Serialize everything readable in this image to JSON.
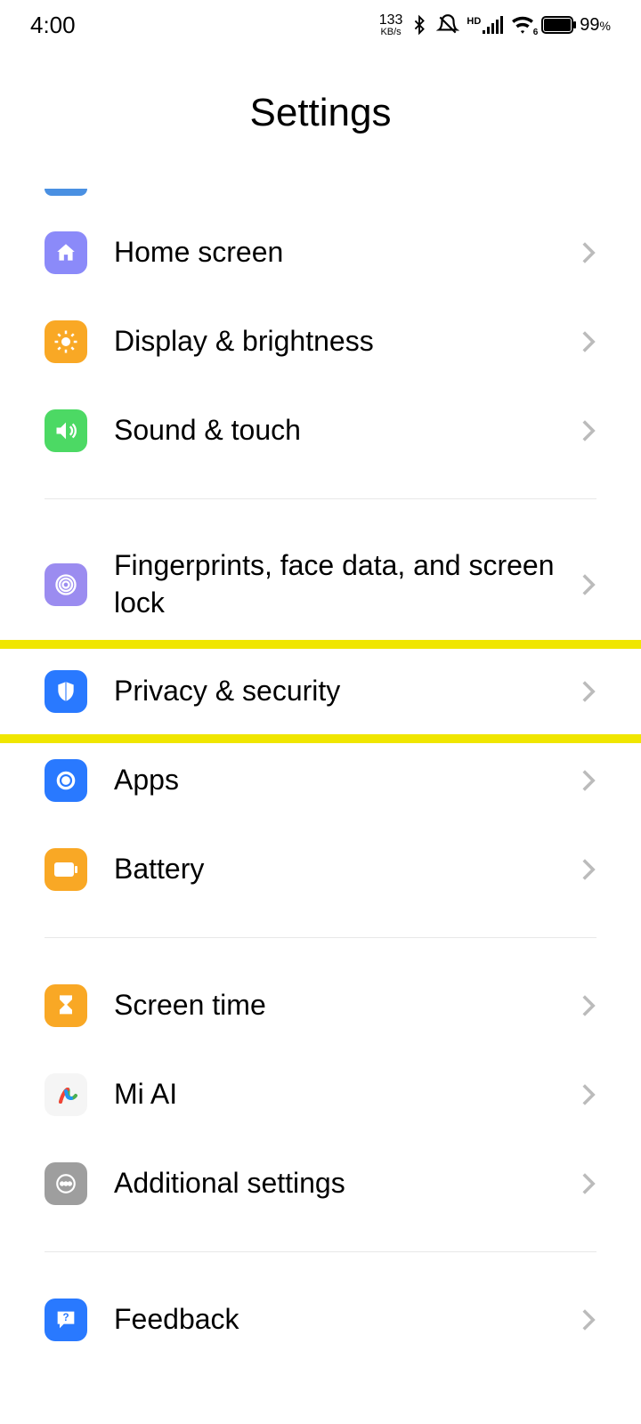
{
  "status_bar": {
    "time": "4:00",
    "speed_value": "133",
    "speed_unit": "KB/s",
    "hd_label": "HD",
    "wifi_sub": "6",
    "battery_pct": "99",
    "battery_pct_suffix": "%"
  },
  "page": {
    "title": "Settings"
  },
  "rows": {
    "home_screen": "Home screen",
    "display_brightness": "Display & brightness",
    "sound_touch": "Sound & touch",
    "fingerprints": "Fingerprints, face data, and screen lock",
    "privacy_security": "Privacy & security",
    "apps": "Apps",
    "battery": "Battery",
    "screen_time": "Screen time",
    "mi_ai": "Mi AI",
    "additional_settings": "Additional settings",
    "feedback": "Feedback"
  }
}
